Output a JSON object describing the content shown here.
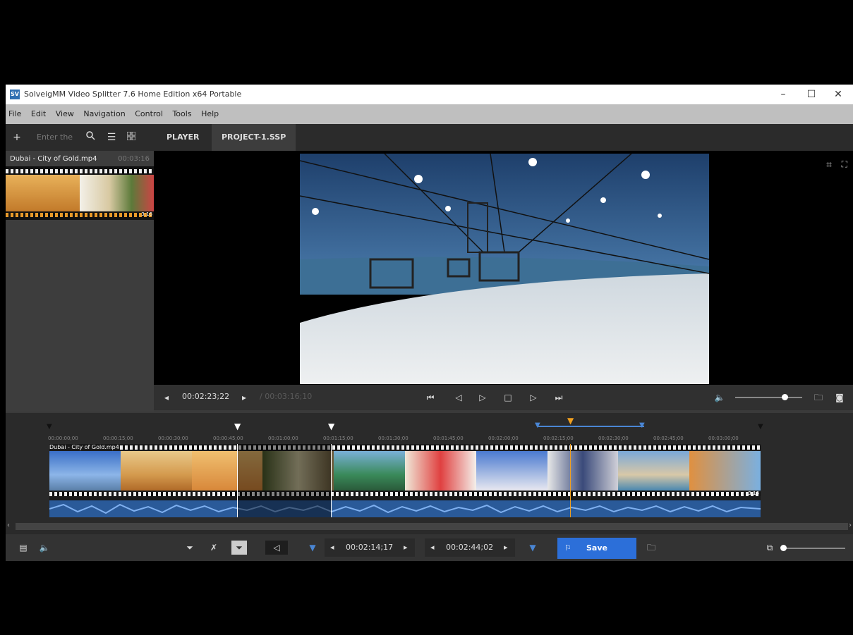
{
  "window": {
    "title": "SolveigMM Video Splitter 7.6 Home Edition x64 Portable",
    "app_icon": "SV",
    "minimize": "–",
    "maximize": "☐",
    "close": "✕"
  },
  "menu": [
    "File",
    "Edit",
    "View",
    "Navigation",
    "Control",
    "Tools",
    "Help"
  ],
  "library": {
    "add_icon": "+",
    "search_placeholder": "Enter the",
    "file_name": "Dubai - City of Gold.mp4",
    "file_duration": "00:03:16",
    "thumb_duration": "3:16"
  },
  "tabs": [
    {
      "label": "PLAYER"
    },
    {
      "label": "PROJECT-1.SSP"
    }
  ],
  "player": {
    "current_time": "00:02:23;22",
    "total_time": "/ 00:03:16;10"
  },
  "timeline": {
    "ruler_ticks": [
      "00:00:00;00",
      "00:00:15;00",
      "00:00:30;00",
      "00:00:45;00",
      "00:01:00;00",
      "00:01:15;00",
      "00:01:30;00",
      "00:01:45;00",
      "00:02:00;00",
      "00:02:15;00",
      "00:02:30;00",
      "00:02:45;00",
      "00:03:00;00"
    ],
    "track_label": "Dubai - City of Gold.mp4",
    "track_end": "3:16"
  },
  "bottom": {
    "marker_in": "00:02:14;17",
    "marker_out": "00:02:44;02",
    "save_label": "Save"
  },
  "colors": {
    "accent": "#2c6fd9",
    "playhead": "#f0a020",
    "waveform": "#4a86d4"
  }
}
